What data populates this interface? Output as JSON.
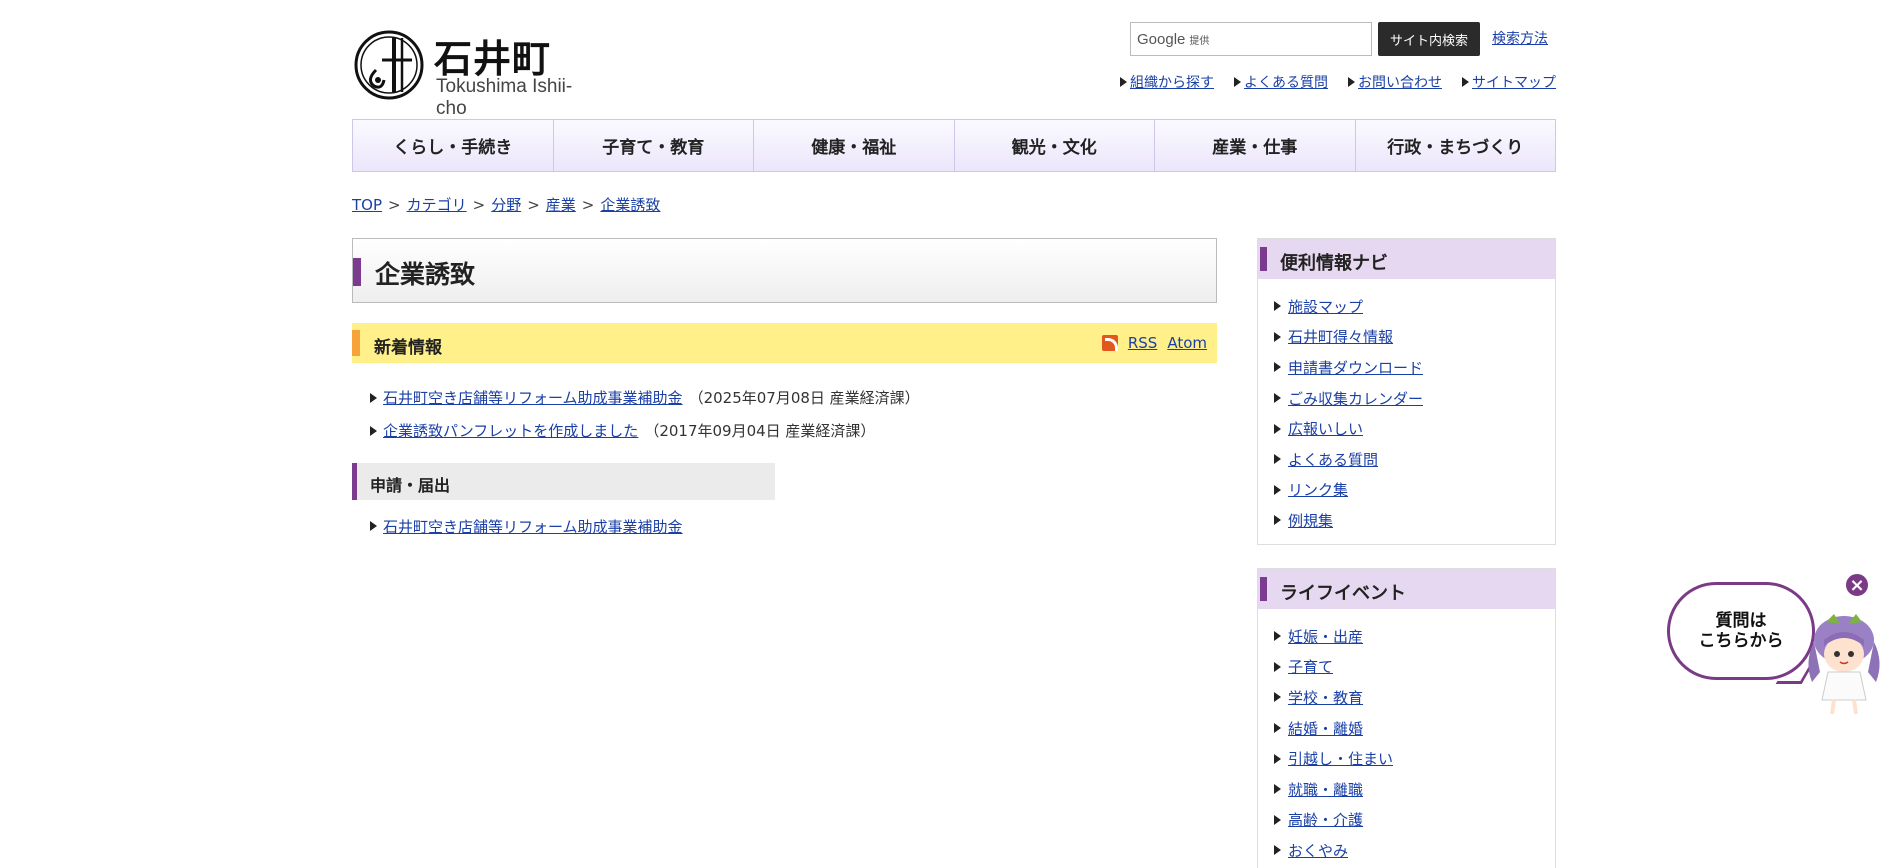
{
  "header": {
    "site_name_jp": "石井町",
    "site_name_en": "Tokushima Ishii-cho",
    "search": {
      "google_label": "Google",
      "provided_label": "提供",
      "button_label": "サイト内検索",
      "howto_label": "検索方法"
    },
    "util_links": [
      "組織から探す",
      "よくある質問",
      "お問い合わせ",
      "サイトマップ"
    ]
  },
  "gnav": [
    "くらし・手続き",
    "子育て・教育",
    "健康・福祉",
    "観光・文化",
    "産業・仕事",
    "行政・まちづくり"
  ],
  "breadcrumb": [
    "TOP",
    "カテゴリ",
    "分野",
    "産業",
    "企業誘致"
  ],
  "breadcrumb_separator": ">",
  "main": {
    "title": "企業誘致",
    "news": {
      "heading": "新着情報",
      "rss_label": "RSS",
      "atom_label": "Atom",
      "items": [
        {
          "link": "石井町空き店舗等リフォーム助成事業補助金",
          "meta": "（2025年07月08日 産業経済課）"
        },
        {
          "link": "企業誘致パンフレットを作成しました",
          "meta": "（2017年09月04日 産業経済課）"
        }
      ]
    },
    "section": {
      "heading": "申請・届出",
      "items": [
        "石井町空き店舗等リフォーム助成事業補助金"
      ]
    }
  },
  "sidebar": {
    "navi": {
      "heading": "便利情報ナビ",
      "items": [
        "施設マップ",
        "石井町得々情報",
        "申請書ダウンロード",
        "ごみ収集カレンダー",
        "広報いしい",
        "よくある質問",
        "リンク集",
        "例規集"
      ]
    },
    "life": {
      "heading": "ライフイベント",
      "items": [
        "妊娠・出産",
        "子育て",
        "学校・教育",
        "結婚・離婚",
        "引越し・住まい",
        "就職・離職",
        "高齢・介護",
        "おくやみ"
      ]
    }
  },
  "chat": {
    "line1": "質問は",
    "line2": "こちらから",
    "close_symbol": "×"
  },
  "colors": {
    "accent_purple": "#7b3b8e",
    "nav_border": "#cfc6ea",
    "news_yellow": "#fff08a",
    "news_bar_orange": "#f6a43a",
    "side_head": "#e7d8f1",
    "link": "#1a3fa6"
  }
}
